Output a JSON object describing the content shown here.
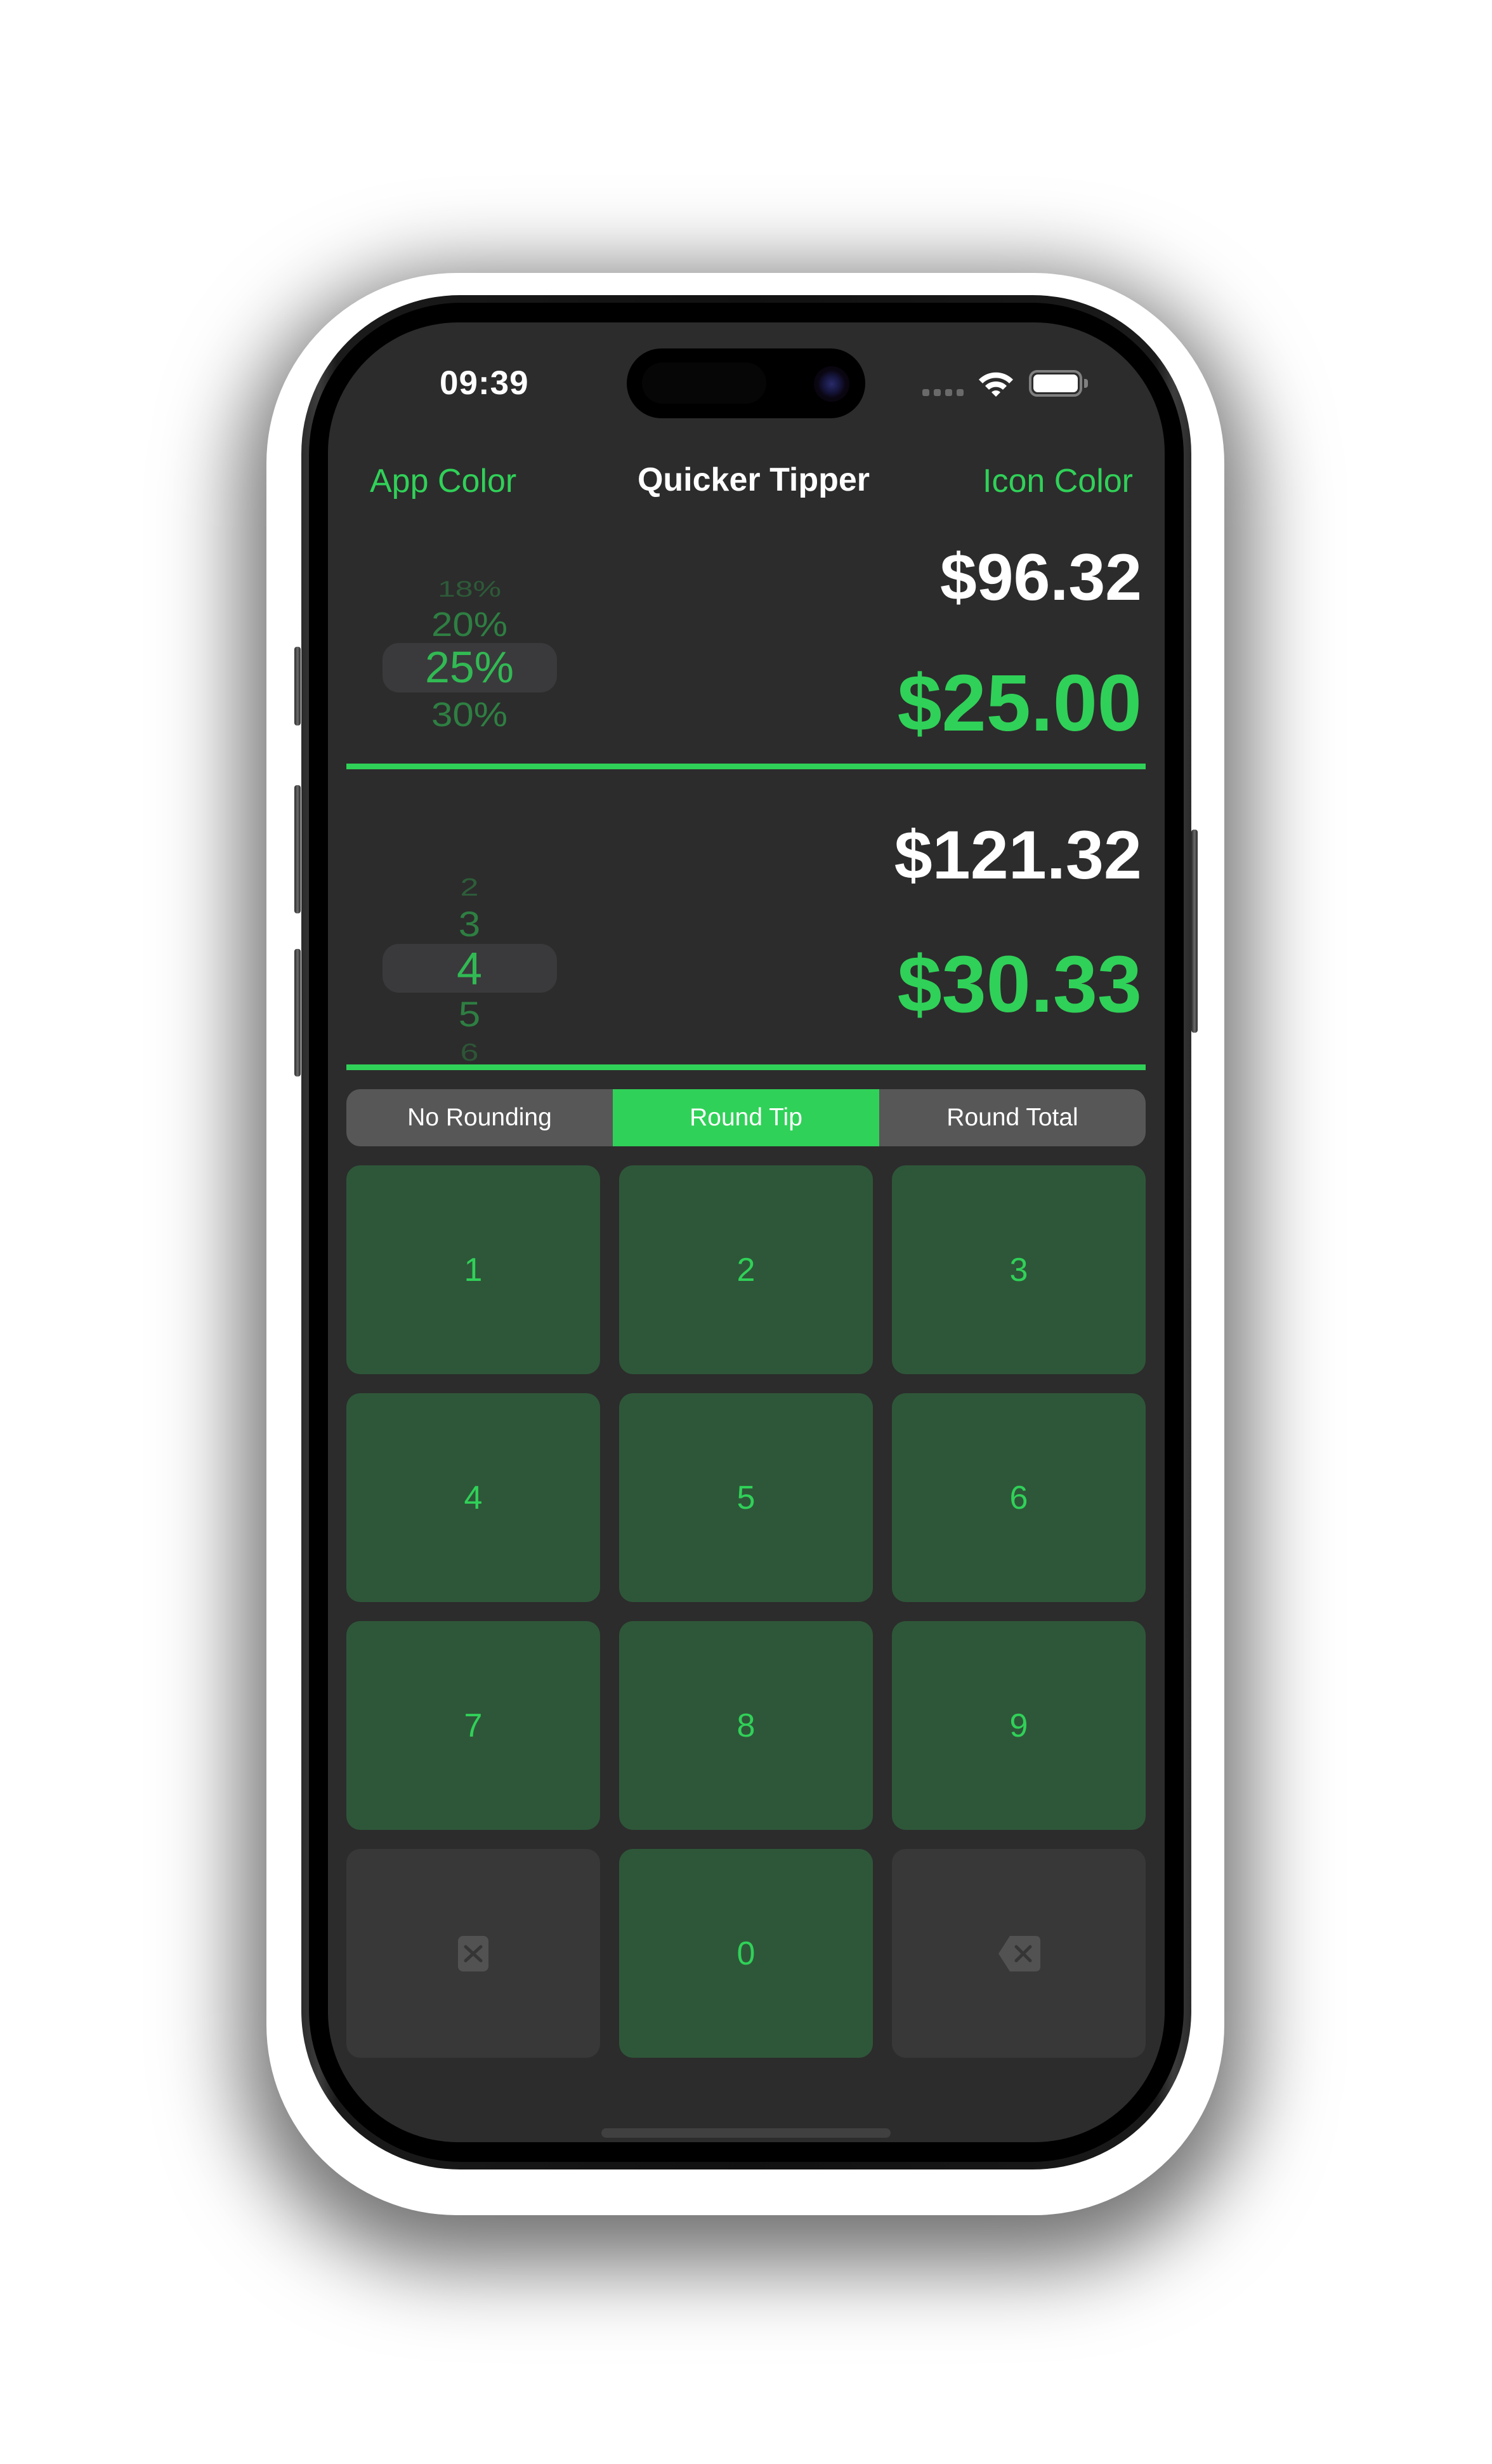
{
  "status_bar": {
    "time": "09:39",
    "signal_icon": "cellular-signal-icon",
    "wifi_icon": "wifi-icon",
    "battery_icon": "battery-full-icon"
  },
  "nav": {
    "left_button": "App Color",
    "title": "Quicker Tipper",
    "right_button": "Icon Color"
  },
  "tip_picker": {
    "items": [
      "18%",
      "20%",
      "25%",
      "30%"
    ],
    "selected": "25%"
  },
  "split_picker": {
    "items": [
      "2",
      "3",
      "4",
      "5",
      "6"
    ],
    "selected": "4"
  },
  "amounts": {
    "bill": "$96.32",
    "tip": "$25.00",
    "total": "$121.32",
    "per_person": "$30.33"
  },
  "rounding": {
    "options": [
      "No Rounding",
      "Round Tip",
      "Round Total"
    ],
    "selected": "Round Tip"
  },
  "keypad": {
    "keys": [
      "1",
      "2",
      "3",
      "4",
      "5",
      "6",
      "7",
      "8",
      "9"
    ],
    "zero": "0",
    "clear_icon": "clear-square-icon",
    "backspace_icon": "delete-backward-icon"
  },
  "colors": {
    "accent": "#30d158",
    "background": "#2c2c2c",
    "key_background": "#2e5739",
    "function_key_background": "#383838",
    "segment_background": "#575757"
  }
}
